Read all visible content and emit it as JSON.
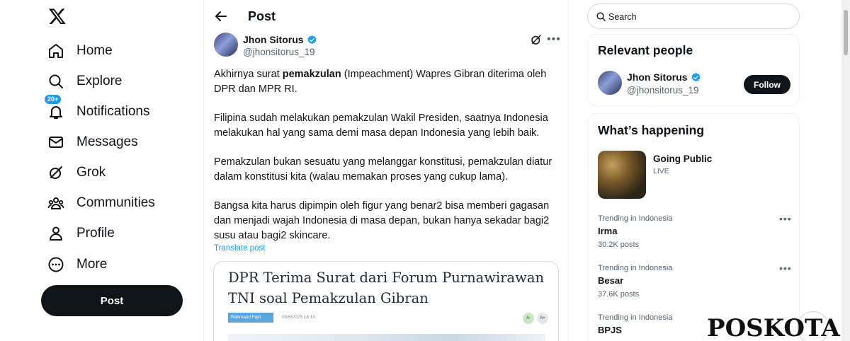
{
  "nav": {
    "items": [
      {
        "label": "Home",
        "icon": "home-icon"
      },
      {
        "label": "Explore",
        "icon": "search-icon"
      },
      {
        "label": "Notifications",
        "icon": "bell-icon",
        "badge": "20+"
      },
      {
        "label": "Messages",
        "icon": "envelope-icon"
      },
      {
        "label": "Grok",
        "icon": "grok-icon"
      },
      {
        "label": "Communities",
        "icon": "people-icon"
      },
      {
        "label": "Profile",
        "icon": "person-icon"
      },
      {
        "label": "More",
        "icon": "more-circle-icon"
      }
    ],
    "post_button": "Post"
  },
  "header": {
    "title": "Post"
  },
  "post": {
    "author_name": "Jhon Sitorus",
    "author_handle": "@jhonsitorus_19",
    "p1_before": "Akhirnya surat ",
    "p1_bold": "pemakzulan",
    "p1_after": " (Impeachment) Wapres Gibran diterima oleh DPR dan MPR RI.",
    "p2": "Filipina sudah melakukan pemakzulan Wakil Presiden, saatnya Indonesia melakukan hal yang sama demi masa depan Indonesia yang lebih baik.",
    "p3": "Pemakzulan bukan sesuatu yang melanggar konstitusi, pemakzulan diatur dalam konstitusi kita (walau memakan proses yang cukup lama).",
    "p4": "Bangsa kita harus dipimpin oleh figur yang benar2 bisa memberi gagasan dan menjadi wajah Indonesia di masa depan, bukan hanya sekadar bagi2 susu atau bagi2 skincare.",
    "translate": "Translate post",
    "card": {
      "headline": "DPR Terima Surat dari Forum Purnawirawan TNI soal Pemakzulan Gibran",
      "author": "Rahmatul Fajri",
      "date": "03/6/2025 18:10",
      "font_small": "A-",
      "font_large": "A+"
    }
  },
  "search": {
    "placeholder": "Search"
  },
  "relevant": {
    "title": "Relevant people",
    "name": "Jhon Sitorus",
    "handle": "@jhonsitorus_19",
    "follow": "Follow"
  },
  "happening": {
    "title": "What’s happening",
    "featured_title": "Going Public",
    "featured_status": "LIVE",
    "trends": [
      {
        "context": "Trending in Indonesia",
        "name": "Irma",
        "count": "30.2K posts"
      },
      {
        "context": "Trending in Indonesia",
        "name": "Besar",
        "count": "37.6K posts"
      },
      {
        "context": "Trending in Indonesia",
        "name": "BPJS",
        "count": ""
      }
    ]
  },
  "watermark": "POSKOTA",
  "colors": {
    "accent": "#1d9bf0",
    "text": "#0f1419",
    "muted": "#536471",
    "border": "#eff3f4"
  }
}
